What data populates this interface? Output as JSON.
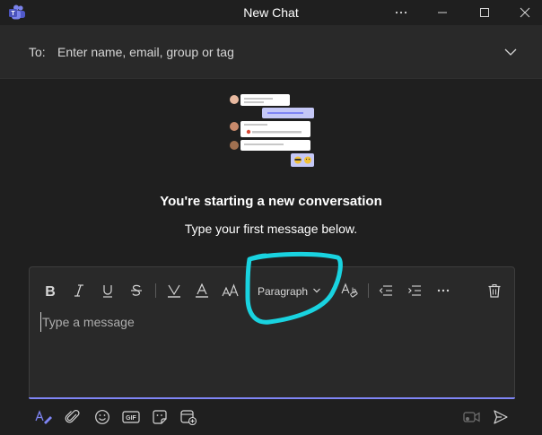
{
  "window": {
    "title": "New Chat"
  },
  "to_bar": {
    "label": "To:",
    "placeholder": "Enter name, email, group or tag"
  },
  "empty_state": {
    "heading": "You're starting a new conversation",
    "subheading": "Type your first message below."
  },
  "compose": {
    "paragraph_label": "Paragraph",
    "placeholder": "Type a message",
    "accent_color": "#7f85f5",
    "annotation_color": "#19d3e0"
  },
  "icons": {
    "toolbar": [
      "bold-icon",
      "italic-icon",
      "underline-icon",
      "strikethrough-icon",
      "highlight-icon",
      "font-color-icon",
      "font-size-icon",
      "paragraph-dropdown",
      "clear-formatting-icon",
      "decrease-indent-icon",
      "increase-indent-icon",
      "more-options-icon",
      "delete-icon"
    ],
    "bottom": [
      "format-icon",
      "attach-icon",
      "emoji-icon",
      "gif-icon",
      "sticker-icon",
      "loop-component-icon",
      "video-clip-icon",
      "send-icon"
    ]
  }
}
